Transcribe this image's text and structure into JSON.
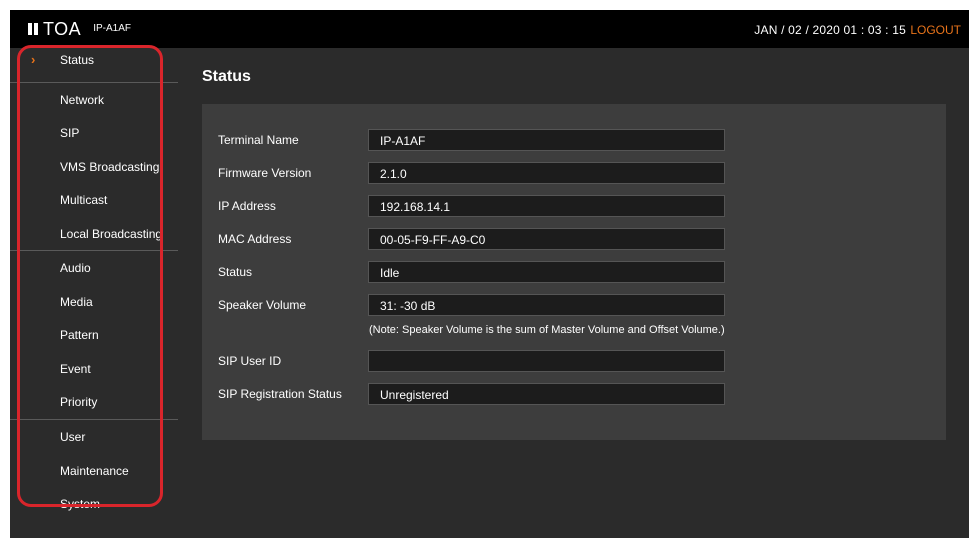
{
  "header": {
    "brand": "TOA",
    "model": "IP-A1AF",
    "datetime": "JAN / 02 / 2020   01 : 03 : 15",
    "logout_label": "LOGOUT"
  },
  "sidebar": {
    "items": [
      {
        "label": "Status"
      },
      {
        "label": "Network"
      },
      {
        "label": "SIP"
      },
      {
        "label": "VMS Broadcasting"
      },
      {
        "label": "Multicast"
      },
      {
        "label": "Local Broadcasting"
      },
      {
        "label": "Audio"
      },
      {
        "label": "Media"
      },
      {
        "label": "Pattern"
      },
      {
        "label": "Event"
      },
      {
        "label": "Priority"
      },
      {
        "label": "User"
      },
      {
        "label": "Maintenance"
      },
      {
        "label": "System"
      }
    ],
    "active_indicator": "›"
  },
  "main": {
    "title": "Status",
    "rows": [
      {
        "label": "Terminal Name",
        "value": "IP-A1AF"
      },
      {
        "label": "Firmware Version",
        "value": "2.1.0"
      },
      {
        "label": "IP Address",
        "value": "192.168.14.1"
      },
      {
        "label": "MAC Address",
        "value": "00-05-F9-FF-A9-C0"
      },
      {
        "label": "Status",
        "value": "Idle"
      },
      {
        "label": "Speaker Volume",
        "value": "31: -30 dB"
      },
      {
        "label": "SIP User ID",
        "value": ""
      },
      {
        "label": "SIP Registration Status",
        "value": "Unregistered"
      }
    ],
    "note": "(Note: Speaker Volume is the sum of Master Volume and Offset Volume.)"
  },
  "colors": {
    "accent": "#e8731a",
    "highlight": "#d9252b",
    "panel": "#3d3d3d",
    "background": "#2b2b2b"
  }
}
